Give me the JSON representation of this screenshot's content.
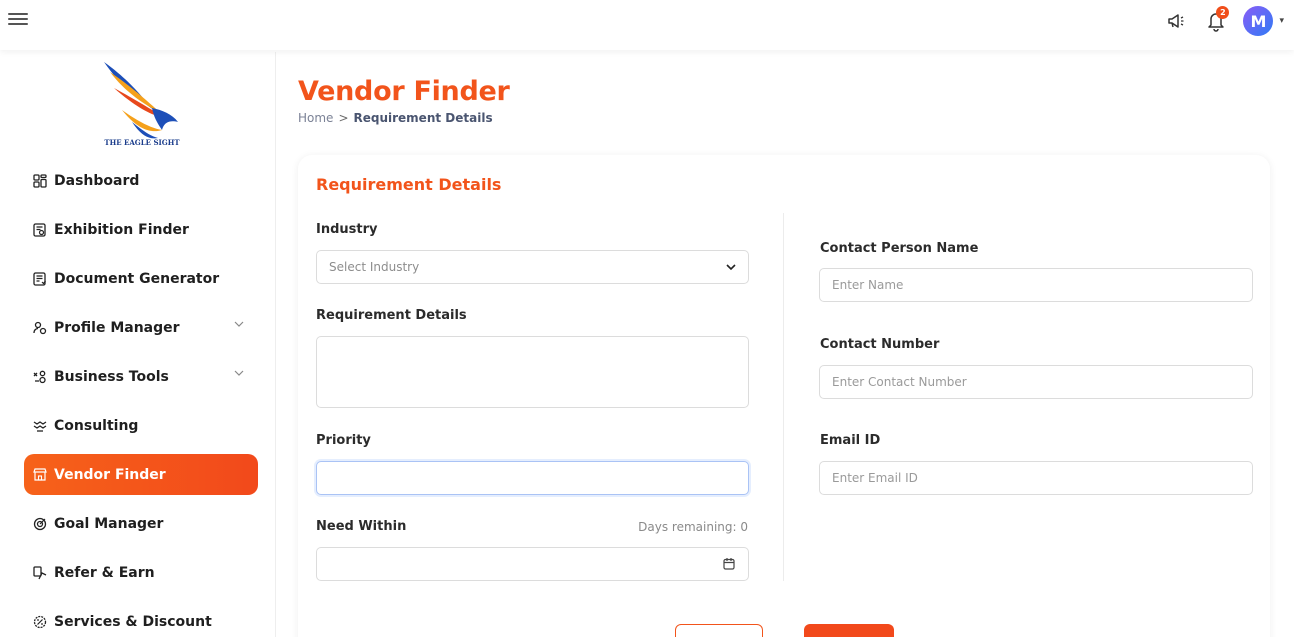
{
  "colors": {
    "accent": "#f2541b",
    "active_nav": "#f6621a",
    "badge": "#f04e1a",
    "avatar": "#5a6cf5"
  },
  "header": {
    "notification_count": "2",
    "avatar_initial": "M"
  },
  "logo": {
    "text": "THE EAGLE SIGHT"
  },
  "sidebar": {
    "items": [
      {
        "label": "Dashboard",
        "icon": "dashboard-icon"
      },
      {
        "label": "Exhibition Finder",
        "icon": "exhibition-icon"
      },
      {
        "label": "Document Generator",
        "icon": "document-icon"
      },
      {
        "label": "Profile Manager",
        "icon": "profile-icon",
        "has_submenu": true
      },
      {
        "label": "Business Tools",
        "icon": "tools-icon",
        "has_submenu": true
      },
      {
        "label": "Consulting",
        "icon": "consulting-icon"
      },
      {
        "label": "Vendor Finder",
        "icon": "vendor-icon",
        "active": true
      },
      {
        "label": "Goal Manager",
        "icon": "goal-icon"
      },
      {
        "label": "Refer & Earn",
        "icon": "refer-icon"
      },
      {
        "label": "Services & Discount",
        "icon": "discount-icon"
      }
    ]
  },
  "page": {
    "title": "Vendor Finder",
    "breadcrumb": {
      "home": "Home",
      "separator": ">",
      "current": "Requirement Details"
    }
  },
  "form": {
    "title": "Requirement Details",
    "industry": {
      "label": "Industry",
      "placeholder": "Select Industry"
    },
    "requirement_details": {
      "label": "Requirement Details"
    },
    "priority": {
      "label": "Priority",
      "value": ""
    },
    "need_within": {
      "label": "Need Within",
      "days_remaining": "Days remaining: 0"
    },
    "contact_person": {
      "label": "Contact Person Name",
      "placeholder": "Enter Name"
    },
    "contact_number": {
      "label": "Contact Number",
      "placeholder": "Enter Contact Number"
    },
    "email": {
      "label": "Email ID",
      "placeholder": "Enter Email ID"
    }
  }
}
